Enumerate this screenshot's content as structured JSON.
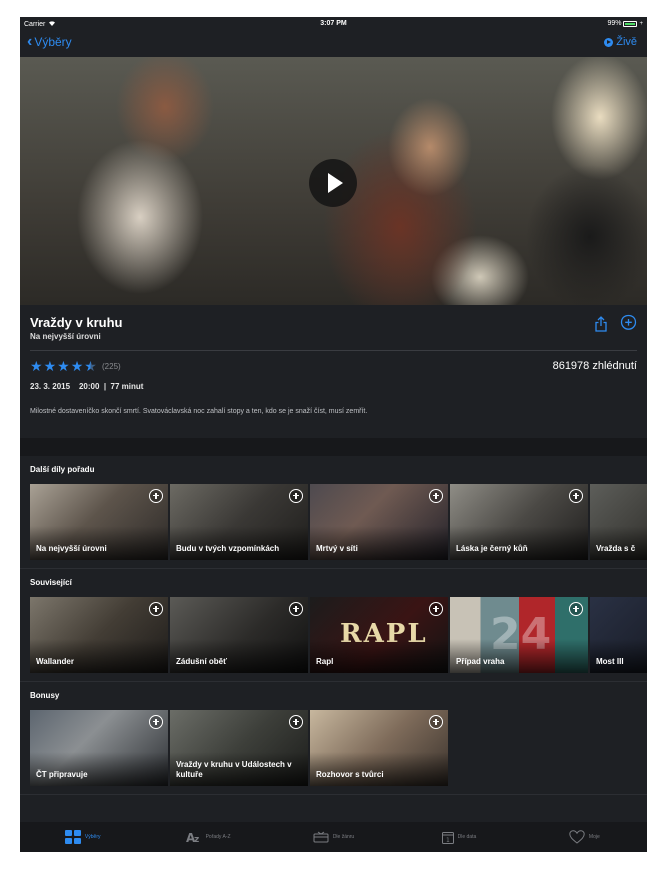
{
  "status_bar": {
    "carrier": "Carrier",
    "time": "3:07 PM",
    "battery": "99%",
    "battery_level": 0.99
  },
  "nav": {
    "back_label": "Výběry",
    "live_label": "Živě"
  },
  "program": {
    "title": "Vraždy v kruhu",
    "subtitle": "Na nejvyšší úrovni",
    "rating": 4.5,
    "rating_count": "(225)",
    "views": "861978 zhlédnutí",
    "date": "23. 3. 2015",
    "time": "20:00",
    "duration": "77 minut",
    "description": "Milostné dostaveníčko skončí smrtí. Svatováclavská noc zahalí stopy a ten, kdo se je snaží číst, musí zemřít."
  },
  "sections": [
    {
      "title": "Další díly pořadu",
      "items": [
        {
          "label": "Na nejvyšší úrovni"
        },
        {
          "label": "Budu v tvých vzpomínkách"
        },
        {
          "label": "Mrtvý v síti"
        },
        {
          "label": "Láska je černý kůň"
        },
        {
          "label": "Vražda s č"
        }
      ]
    },
    {
      "title": "Související",
      "items": [
        {
          "label": "Wallander"
        },
        {
          "label": "Zádušní oběť"
        },
        {
          "label": "Rapl",
          "logo": "RAPL"
        },
        {
          "label": "Případ vraha",
          "logo": "24"
        },
        {
          "label": "Most III"
        }
      ]
    },
    {
      "title": "Bonusy",
      "items": [
        {
          "label": "ČT připravuje"
        },
        {
          "label": "Vraždy v kruhu v Událostech v kultuře"
        },
        {
          "label": "Rozhovor s tvůrci"
        }
      ]
    }
  ],
  "tabs": [
    {
      "label": "Výběry",
      "icon": "grid-icon",
      "active": true
    },
    {
      "label": "Pořady A-Z",
      "icon": "az-icon"
    },
    {
      "label": "Dle žánru",
      "icon": "genre-icon"
    },
    {
      "label": "Dle data",
      "icon": "calendar-icon"
    },
    {
      "label": "Moje",
      "icon": "heart-icon"
    }
  ],
  "colors": {
    "accent": "#2e8bf0",
    "background": "#1e2024"
  }
}
